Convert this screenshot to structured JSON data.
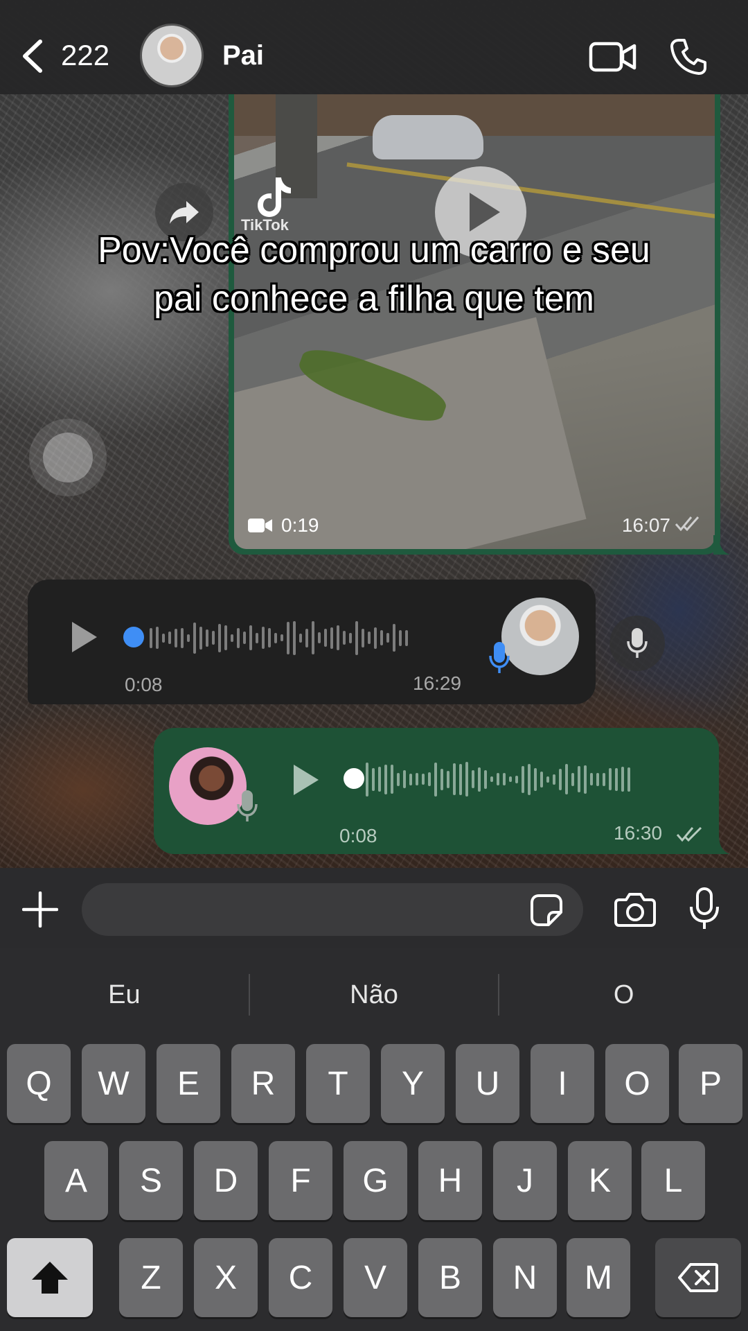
{
  "header": {
    "back_label": "",
    "unread_count": "222",
    "contact_name": "Pai"
  },
  "video_message": {
    "watermark": "TikTok",
    "duration": "0:19",
    "time": "16:07"
  },
  "caption": {
    "text": "Pov:Você comprou um carro e seu pai conhece a filha que tem"
  },
  "incoming_audio": {
    "duration": "0:08",
    "time": "16:29"
  },
  "outgoing_audio": {
    "duration": "0:08",
    "time": "16:30"
  },
  "composer": {
    "placeholder": ""
  },
  "keyboard": {
    "suggestions": [
      "Eu",
      "Não",
      "O"
    ],
    "row1": [
      "Q",
      "W",
      "E",
      "R",
      "T",
      "Y",
      "U",
      "I",
      "O",
      "P"
    ],
    "row2": [
      "A",
      "S",
      "D",
      "F",
      "G",
      "H",
      "J",
      "K",
      "L"
    ],
    "row3": [
      "Z",
      "X",
      "C",
      "V",
      "B",
      "N",
      "M"
    ]
  },
  "icons": {
    "back": "chevron-left-icon",
    "video_call": "video-camera-icon",
    "voice_call": "phone-icon",
    "forward": "forward-arrow-icon",
    "play": "play-icon",
    "mic": "microphone-icon",
    "plus": "plus-icon",
    "sticker": "sticker-icon",
    "camera": "camera-icon",
    "shift": "shift-arrow-icon",
    "backspace": "backspace-icon"
  },
  "colors": {
    "outgoing_bubble": "#1e5236",
    "incoming_bubble": "#202020",
    "audio_progress_incoming": "#3f8ef5"
  }
}
